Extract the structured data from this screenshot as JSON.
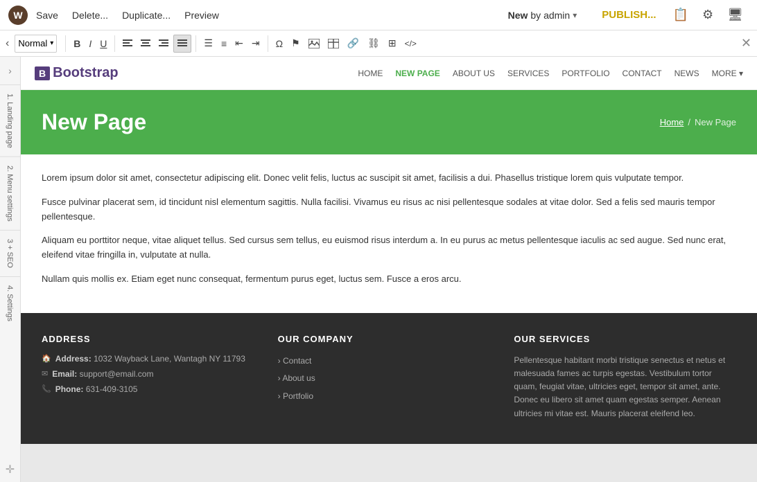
{
  "topbar": {
    "logo_text": "W",
    "save_label": "Save",
    "delete_label": "Delete...",
    "duplicate_label": "Duplicate...",
    "preview_label": "Preview",
    "status": "New",
    "by_label": "by admin",
    "publish_label": "PUBLISH...",
    "close_symbol": "✕"
  },
  "toolbar": {
    "collapse_symbol": "‹",
    "format_label": "Normal",
    "format_arrow": "▾",
    "close_symbol": "✕",
    "buttons": [
      {
        "name": "bold",
        "label": "B",
        "active": false
      },
      {
        "name": "italic",
        "label": "I",
        "active": false
      },
      {
        "name": "underline",
        "label": "U",
        "active": false
      },
      {
        "name": "align-left",
        "label": "≡",
        "active": false
      },
      {
        "name": "align-center",
        "label": "≡",
        "active": false
      },
      {
        "name": "align-right",
        "label": "≡",
        "active": false
      },
      {
        "name": "align-justify",
        "label": "≡",
        "active": true
      },
      {
        "name": "ul",
        "label": "≡",
        "active": false
      },
      {
        "name": "ol",
        "label": "≡",
        "active": false
      },
      {
        "name": "indent-out",
        "label": "⇤",
        "active": false
      },
      {
        "name": "indent-in",
        "label": "⇥",
        "active": false
      },
      {
        "name": "omega",
        "label": "Ω",
        "active": false
      },
      {
        "name": "flag",
        "label": "⚑",
        "active": false
      },
      {
        "name": "image",
        "label": "🖼",
        "active": false
      },
      {
        "name": "table-edit",
        "label": "▦",
        "active": false
      },
      {
        "name": "link",
        "label": "🔗",
        "active": false
      },
      {
        "name": "unlink",
        "label": "⛓",
        "active": false
      },
      {
        "name": "table",
        "label": "⊞",
        "active": false
      },
      {
        "name": "code",
        "label": "</>",
        "active": false
      }
    ]
  },
  "sidebar": {
    "toggle_symbol": "›",
    "items": [
      {
        "num": "1.",
        "label": "Landing page"
      },
      {
        "num": "2.",
        "label": "Menu settings"
      },
      {
        "num": "3+.",
        "label": "SEO"
      },
      {
        "num": "4.",
        "label": "Settings"
      }
    ]
  },
  "navbar": {
    "brand": "Bootstrap",
    "links": [
      {
        "label": "HOME",
        "active": false
      },
      {
        "label": "NEW PAGE",
        "active": true
      },
      {
        "label": "ABOUT US",
        "active": false
      },
      {
        "label": "SERVICES",
        "active": false
      },
      {
        "label": "PORTFOLIO",
        "active": false
      },
      {
        "label": "CONTACT",
        "active": false
      },
      {
        "label": "NEWS",
        "active": false
      },
      {
        "label": "MORE",
        "active": false,
        "dropdown": true
      }
    ]
  },
  "hero": {
    "title": "New Page",
    "breadcrumb_home": "Home",
    "breadcrumb_sep": "/",
    "breadcrumb_current": "New Page"
  },
  "content": {
    "paragraphs": [
      "Lorem ipsum dolor sit amet, consectetur adipiscing elit. Donec velit felis, luctus ac suscipit sit amet, facilisis a dui. Phasellus tristique lorem quis vulputate tempor.",
      "Fusce pulvinar placerat sem, id tincidunt nisl elementum sagittis. Nulla facilisi. Vivamus eu risus ac nisi pellentesque sodales at vitae dolor. Sed a felis sed mauris tempor pellentesque.",
      "Aliquam eu porttitor neque, vitae aliquet tellus. Sed cursus sem tellus, eu euismod risus interdum a. In eu purus ac metus pellentesque iaculis ac sed augue. Sed nunc erat, eleifend vitae fringilla in, vulputate at nulla.",
      "Nullam quis mollis ex. Etiam eget nunc consequat, fermentum purus eget, luctus sem. Fusce a eros arcu."
    ]
  },
  "footer": {
    "address_title": "ADDRESS",
    "address_label": "Address:",
    "address_value": "1032 Wayback Lane, Wantagh NY 11793",
    "email_label": "Email:",
    "email_value": "support@email.com",
    "phone_label": "Phone:",
    "phone_value": "631-409-3105",
    "company_title": "OUR COMPANY",
    "company_links": [
      "Contact",
      "About us",
      "Portfolio"
    ],
    "services_title": "OUR SERVICES",
    "services_text": "Pellentesque habitant morbi tristique senectus et netus et malesuada fames ac turpis egestas. Vestibulum tortor quam, feugiat vitae, ultricies eget, tempor sit amet, ante. Donec eu libero sit amet quam egestas semper. Aenean ultricies mi vitae est. Mauris placerat eleifend leo."
  }
}
